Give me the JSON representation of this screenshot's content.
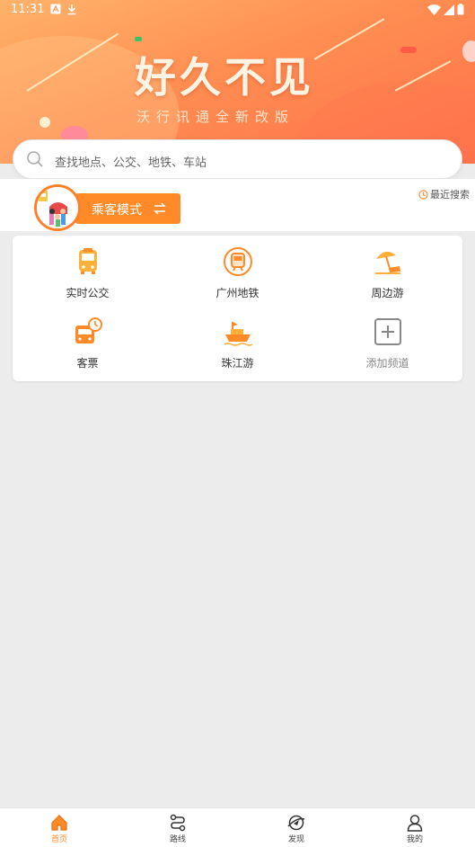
{
  "status_bar": {
    "time": "11:31"
  },
  "banner": {
    "title": "好久不见",
    "subtitle": "沃行讯通全新改版"
  },
  "search": {
    "placeholder": "查找地点、公交、地铁、车站"
  },
  "mode": {
    "label": "乘客模式"
  },
  "recent_search": {
    "label": "最近搜索"
  },
  "grid": {
    "items": [
      {
        "label": "实时公交",
        "icon": "bus-icon"
      },
      {
        "label": "广州地铁",
        "icon": "metro-icon"
      },
      {
        "label": "周边游",
        "icon": "beach-umbrella-icon"
      },
      {
        "label": "客票",
        "icon": "ticket-bus-icon"
      },
      {
        "label": "珠江游",
        "icon": "ship-icon"
      },
      {
        "label": "添加频道",
        "icon": "add-channel-icon"
      }
    ]
  },
  "tabbar": {
    "tabs": [
      {
        "label": "首页",
        "icon": "home-icon",
        "active": true
      },
      {
        "label": "路线",
        "icon": "route-icon",
        "active": false
      },
      {
        "label": "发现",
        "icon": "discover-icon",
        "active": false
      },
      {
        "label": "我的",
        "icon": "profile-icon",
        "active": false
      }
    ]
  },
  "colors": {
    "accent": "#ff8a27",
    "banner": "#ff8e52",
    "background": "#ececec"
  }
}
